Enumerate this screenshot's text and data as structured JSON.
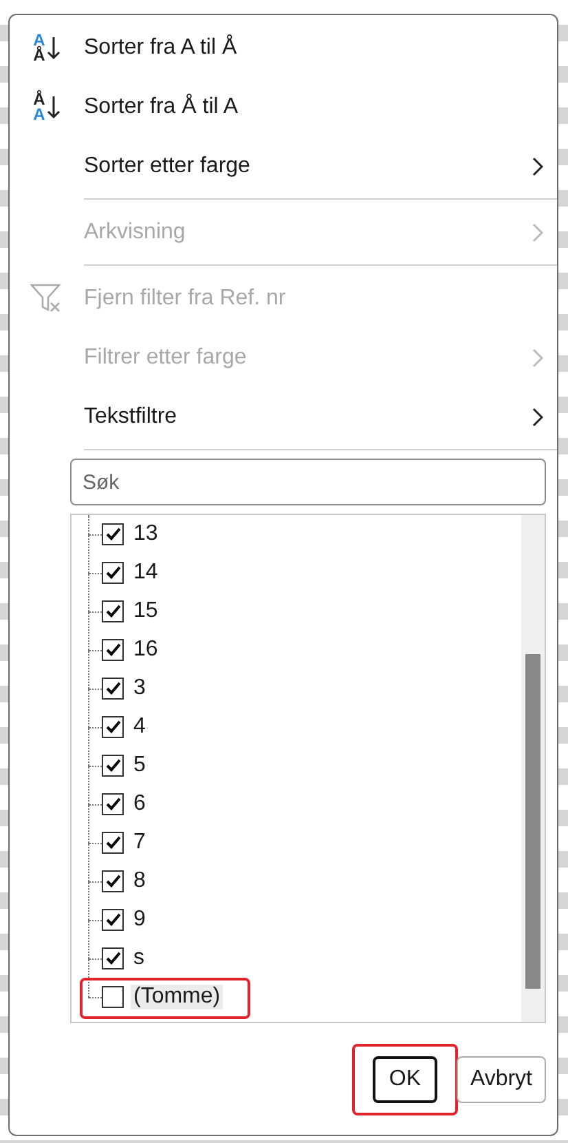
{
  "menu": {
    "items": [
      {
        "kind": "sort_asc",
        "label": "Sorter fra A til Å",
        "letters": [
          "A",
          "Å"
        ],
        "disabled": false,
        "submenu": false
      },
      {
        "kind": "sort_desc",
        "label": "Sorter fra Å til A",
        "letters": [
          "Å",
          "A"
        ],
        "disabled": false,
        "submenu": false
      },
      {
        "kind": "plain",
        "label": "Sorter etter farge",
        "disabled": false,
        "submenu": true
      },
      {
        "kind": "separator"
      },
      {
        "kind": "plain",
        "label": "Arkvisning",
        "disabled": true,
        "submenu": true
      },
      {
        "kind": "separator"
      },
      {
        "kind": "clear_filter",
        "label": "Fjern filter fra Ref. nr",
        "disabled": true,
        "submenu": false
      },
      {
        "kind": "plain",
        "label": "Filtrer etter farge",
        "disabled": true,
        "submenu": true
      },
      {
        "kind": "plain",
        "label": "Tekstfiltre",
        "disabled": false,
        "submenu": true
      },
      {
        "kind": "separator"
      }
    ]
  },
  "search": {
    "placeholder": "Søk"
  },
  "values": [
    {
      "label": "13",
      "checked": true,
      "highlighted": false
    },
    {
      "label": "14",
      "checked": true,
      "highlighted": false
    },
    {
      "label": "15",
      "checked": true,
      "highlighted": false
    },
    {
      "label": "16",
      "checked": true,
      "highlighted": false
    },
    {
      "label": "3",
      "checked": true,
      "highlighted": false
    },
    {
      "label": "4",
      "checked": true,
      "highlighted": false
    },
    {
      "label": "5",
      "checked": true,
      "highlighted": false
    },
    {
      "label": "6",
      "checked": true,
      "highlighted": false
    },
    {
      "label": "7",
      "checked": true,
      "highlighted": false
    },
    {
      "label": "8",
      "checked": true,
      "highlighted": false
    },
    {
      "label": "9",
      "checked": true,
      "highlighted": false
    },
    {
      "label": "s",
      "checked": true,
      "highlighted": false
    },
    {
      "label": "(Tomme)",
      "checked": false,
      "highlighted": true
    }
  ],
  "buttons": [
    {
      "label": "OK",
      "default": true,
      "highlighted": true
    },
    {
      "label": "Avbryt",
      "default": false,
      "highlighted": false
    }
  ]
}
